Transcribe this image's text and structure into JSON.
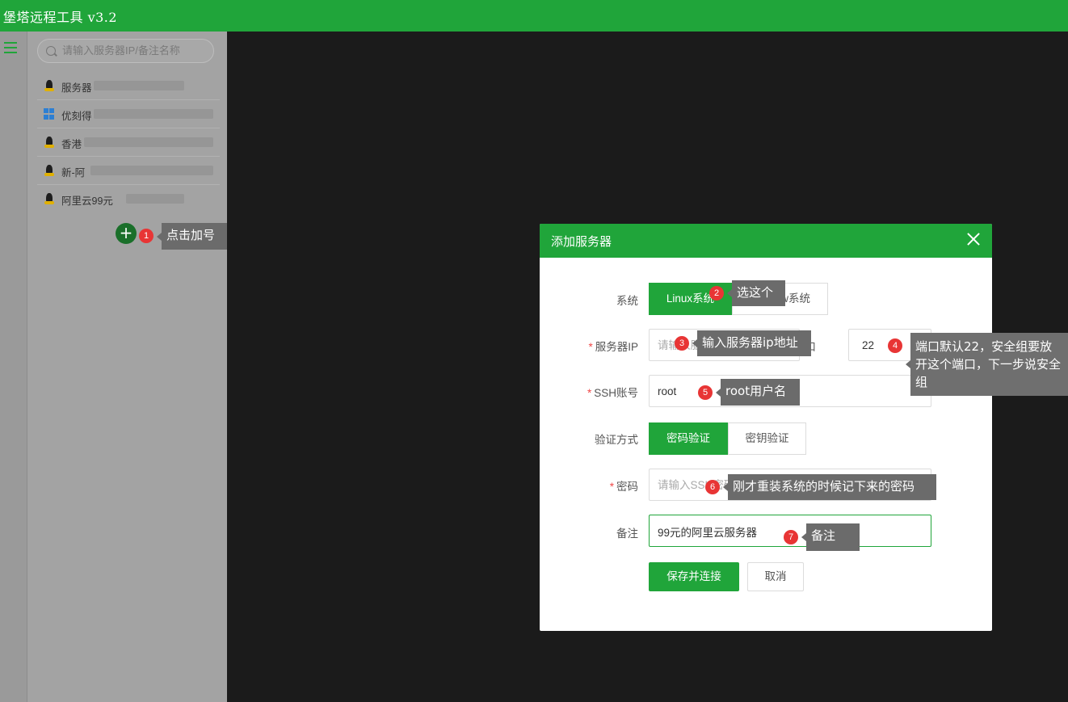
{
  "app": {
    "title": "堡塔远程工具 v3.2"
  },
  "sidebar": {
    "search_placeholder": "请输入服务器IP/备注名称",
    "servers": [
      {
        "os": "linux",
        "name": "服务器"
      },
      {
        "os": "windows",
        "name": "优刻得"
      },
      {
        "os": "linux",
        "name": "香港"
      },
      {
        "os": "linux",
        "name": "新-阿"
      },
      {
        "os": "linux",
        "name": "阿里云99元"
      }
    ],
    "add_icon": "+"
  },
  "dialog": {
    "title": "添加服务器",
    "os_label": "系统",
    "os_options": [
      "Linux系统",
      "Window系统"
    ],
    "ip_label": "服务器IP",
    "ip_placeholder": "请输入服务器IP",
    "port_label": "端口",
    "port_value": "22",
    "ssh_label": "SSH账号",
    "ssh_value": "root",
    "auth_label": "验证方式",
    "auth_options": [
      "密码验证",
      "密钥验证"
    ],
    "pwd_label": "密码",
    "pwd_placeholder": "请输入SSH密码",
    "note_label": "备注",
    "note_value": "99元的阿里云服务器",
    "save_label": "保存并连接",
    "cancel_label": "取消",
    "required_mark": "*"
  },
  "annotations": [
    {
      "num": "1",
      "text": "点击加号"
    },
    {
      "num": "2",
      "text": "选这个"
    },
    {
      "num": "3",
      "text": "输入服务器ip地址"
    },
    {
      "num": "4",
      "text": "端口默认22，安全组要放开这个端口，下一步说安全组"
    },
    {
      "num": "5",
      "text": "root用户名"
    },
    {
      "num": "6",
      "text": "刚才重装系统的时候记下来的密码"
    },
    {
      "num": "7",
      "text": "备注"
    }
  ],
  "colors": {
    "brand": "#20a53a",
    "badge": "#e83535",
    "tooltip": "#6b6b6b"
  }
}
